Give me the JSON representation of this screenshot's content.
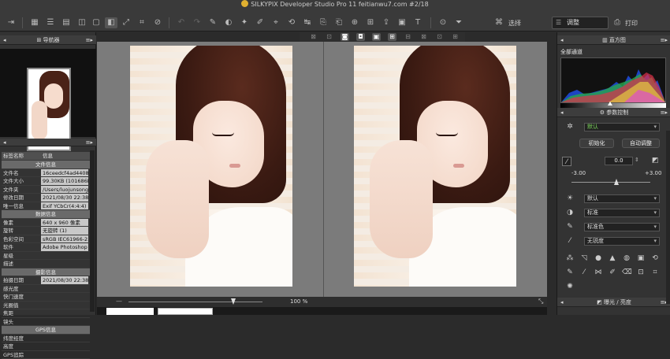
{
  "window": {
    "title": "SILKYPIX Developer Studio Pro 11 feitianwu7.com  #2/18"
  },
  "toolbar": {
    "icons": [
      "import-icon",
      "grid-icon",
      "list-icon",
      "thumb-icon",
      "compare-icon",
      "single-icon",
      "dual-icon",
      "fit-icon",
      "crop-icon",
      "no-icon",
      "undo-icon",
      "redo-icon",
      "stamp-icon",
      "tone-icon",
      "transform-icon",
      "rotate-icon",
      "color-icon",
      "paste-icon",
      "export-icon",
      "palette-icon",
      "text-icon",
      "loupe-icon",
      "filter-icon"
    ],
    "select_label": "选择",
    "adjust_value": "调整",
    "print_label": "打印"
  },
  "navigator": {
    "title": "导航器"
  },
  "info": {
    "columns": {
      "name": "标签名称",
      "value": "信息"
    },
    "rows": [
      {
        "type": "section",
        "label": "文件信息"
      },
      {
        "type": "kv",
        "k": "文件名",
        "v": "16ceedcf4ad4408a2"
      },
      {
        "type": "kv",
        "k": "文件大小",
        "v": "99.30KB (101686By"
      },
      {
        "type": "kv",
        "k": "文件夹",
        "v": "/Users/luojunsong/D"
      },
      {
        "type": "kv",
        "k": "修改日期",
        "v": "2021/08/30 22:38:4"
      },
      {
        "type": "kv",
        "k": "唯一信息",
        "v": "Exif YCbCr(4:4:4)"
      },
      {
        "type": "section",
        "label": "数据信息"
      },
      {
        "type": "kv",
        "k": "像素",
        "v": "640 x 960 像素"
      },
      {
        "type": "kv",
        "k": "旋转",
        "v": "无旋转 (1)"
      },
      {
        "type": "kv",
        "k": "色彩空间",
        "v": "sRGB IEC61966-2.1"
      },
      {
        "type": "kv",
        "k": "软件",
        "v": "Adobe Photoshop C"
      },
      {
        "type": "kv",
        "k": "星级",
        "v": ""
      },
      {
        "type": "kv",
        "k": "描述",
        "v": ""
      },
      {
        "type": "section",
        "label": "摄影信息"
      },
      {
        "type": "kv",
        "k": "拍摄日期",
        "v": "2021/08/30 22:38"
      },
      {
        "type": "kv",
        "k": "感光度",
        "v": ""
      },
      {
        "type": "kv",
        "k": "快门速度",
        "v": ""
      },
      {
        "type": "kv",
        "k": "光圈值",
        "v": ""
      },
      {
        "type": "kv",
        "k": "焦距",
        "v": ""
      },
      {
        "type": "kv",
        "k": "镜头",
        "v": ""
      },
      {
        "type": "section",
        "label": "GPS信息"
      },
      {
        "type": "kv",
        "k": "纬度经度",
        "v": ""
      },
      {
        "type": "kv",
        "k": "高度",
        "v": ""
      },
      {
        "type": "kv",
        "k": "GPS追踪",
        "v": ""
      }
    ]
  },
  "zoom": {
    "value": "100 %"
  },
  "histogram": {
    "title": "直方图",
    "channel": "全部通道"
  },
  "params": {
    "title": "参数控制",
    "preset": "默认",
    "init_button": "初始化",
    "auto_button": "自动调整",
    "exposure_value": "0.0",
    "range_min": "-3.00",
    "range_max": "+3.00",
    "wb": "默认",
    "tone": "标准",
    "color": "标准色",
    "sharp": "无锐度",
    "footer": "曝光 / 亮度"
  }
}
